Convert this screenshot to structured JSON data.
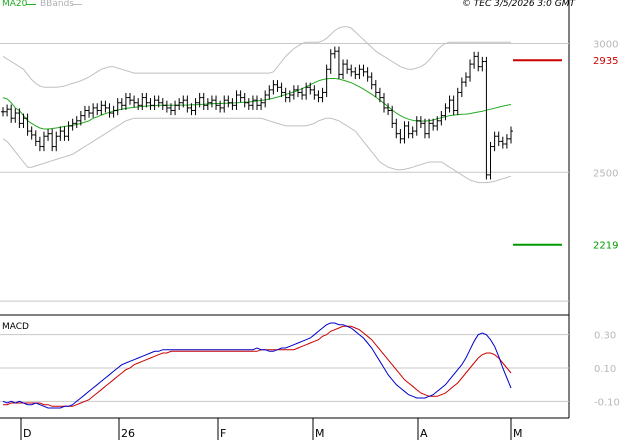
{
  "legend": {
    "ma_label": "MA20",
    "bb_label": "BBands",
    "ma_color": "#22aa22",
    "bb_color": "#c0c0c0"
  },
  "header": {
    "info": "© TEC 3/5/2026 3:0 GMT"
  },
  "price_axis": {
    "ticks": [
      {
        "label": "3000",
        "value": 3000
      },
      {
        "label": "2500",
        "value": 2500
      }
    ]
  },
  "levels": [
    {
      "label": "2935",
      "value": 2935,
      "color": "#cc0000"
    },
    {
      "label": "2219",
      "value": 2219,
      "color": "#009900"
    }
  ],
  "macd": {
    "title": "MACD",
    "ticks": [
      {
        "label": "0.30",
        "value": 0.3
      },
      {
        "label": "0.10",
        "value": 0.1
      },
      {
        "label": "-0.10",
        "value": -0.1
      }
    ],
    "macd_color": "#0000cc",
    "signal_color": "#cc0000"
  },
  "x_axis": {
    "labels": [
      "D",
      "26",
      "F",
      "M",
      "A",
      "M"
    ]
  },
  "chart_data": [
    {
      "type": "ohlc",
      "title": "",
      "x": [
        "D",
        "",
        "",
        "",
        "",
        "",
        "",
        "",
        "",
        "",
        "",
        "",
        "",
        "",
        "",
        "",
        "",
        "",
        "",
        "",
        "",
        "",
        "",
        "",
        "",
        "",
        "",
        "",
        "",
        "",
        "",
        "",
        "",
        "",
        "",
        "",
        "",
        "",
        "",
        "",
        "26",
        "",
        "",
        "",
        "",
        "",
        "",
        "",
        "",
        "",
        "",
        "",
        "",
        "",
        "",
        "",
        "",
        "",
        "",
        "",
        "",
        "",
        "",
        "",
        "",
        "",
        "",
        "",
        "",
        "",
        "F",
        "",
        "",
        "",
        "",
        "",
        "",
        "",
        "",
        "",
        "",
        "",
        "",
        "",
        "",
        "",
        "",
        "",
        "",
        "",
        "",
        "",
        "",
        "",
        "",
        "",
        "",
        "",
        "",
        "",
        "M",
        "",
        "",
        "",
        "",
        "",
        "",
        "",
        "",
        "",
        "",
        "",
        "",
        "",
        "",
        "",
        "",
        "",
        "",
        "",
        "",
        "",
        "",
        "",
        "",
        "",
        "",
        "",
        "",
        "",
        "A",
        "",
        "",
        "",
        "",
        "",
        "",
        "",
        "",
        "",
        "",
        "",
        "",
        "",
        "",
        "",
        "",
        "",
        "",
        "",
        "",
        "",
        "",
        "",
        "",
        "M"
      ],
      "ylim": [
        1950,
        3130
      ],
      "close": [
        2735,
        2745,
        2710,
        2730,
        2690,
        2710,
        2660,
        2645,
        2620,
        2600,
        2640,
        2650,
        2600,
        2640,
        2660,
        2640,
        2680,
        2690,
        2700,
        2720,
        2740,
        2730,
        2750,
        2740,
        2760,
        2750,
        2730,
        2740,
        2770,
        2760,
        2790,
        2780,
        2770,
        2760,
        2790,
        2770,
        2760,
        2780,
        2770,
        2760,
        2750,
        2740,
        2760,
        2770,
        2780,
        2750,
        2740,
        2770,
        2790,
        2760,
        2770,
        2780,
        2760,
        2750,
        2780,
        2770,
        2760,
        2800,
        2790,
        2770,
        2760,
        2780,
        2760,
        2770,
        2800,
        2820,
        2840,
        2830,
        2810,
        2790,
        2800,
        2820,
        2810,
        2800,
        2830,
        2820,
        2800,
        2790,
        2810,
        2900,
        2960,
        2970,
        2880,
        2920,
        2900,
        2890,
        2880,
        2900,
        2890,
        2870,
        2840,
        2810,
        2790,
        2750,
        2740,
        2690,
        2650,
        2630,
        2680,
        2650,
        2660,
        2700,
        2690,
        2650,
        2690,
        2680,
        2700,
        2720,
        2750,
        2780,
        2740,
        2810,
        2850,
        2870,
        2920,
        2950,
        2910,
        2930,
        2490,
        2600,
        2640,
        2620,
        2610,
        2630,
        2660
      ],
      "ma20": [
        2790,
        2785,
        2770,
        2750,
        2740,
        2720,
        2700,
        2690,
        2680,
        2672,
        2668,
        2668,
        2670,
        2672,
        2675,
        2678,
        2680,
        2683,
        2686,
        2690,
        2695,
        2700,
        2710,
        2715,
        2722,
        2728,
        2733,
        2738,
        2742,
        2745,
        2748,
        2750,
        2752,
        2754,
        2756,
        2757,
        2758,
        2759,
        2760,
        2760,
        2760,
        2760,
        2760,
        2761,
        2761,
        2761,
        2762,
        2762,
        2763,
        2764,
        2765,
        2766,
        2767,
        2767,
        2768,
        2768,
        2769,
        2770,
        2771,
        2772,
        2773,
        2775,
        2777,
        2779,
        2781,
        2784,
        2788,
        2792,
        2797,
        2802,
        2807,
        2812,
        2818,
        2825,
        2832,
        2840,
        2848,
        2855,
        2860,
        2863,
        2864,
        2864,
        2862,
        2858,
        2853,
        2848,
        2840,
        2832,
        2823,
        2813,
        2803,
        2792,
        2780,
        2768,
        2755,
        2742,
        2730,
        2720,
        2712,
        2706,
        2702,
        2699,
        2698,
        2699,
        2700,
        2703,
        2708,
        2712,
        2716,
        2720,
        2722,
        2724,
        2725,
        2726,
        2728,
        2731,
        2734,
        2737,
        2741,
        2745,
        2749,
        2753,
        2757,
        2760,
        2763
      ],
      "bb_upper": [
        2950,
        2940,
        2930,
        2920,
        2910,
        2900,
        2880,
        2860,
        2845,
        2835,
        2830,
        2830,
        2830,
        2830,
        2832,
        2835,
        2840,
        2845,
        2850,
        2855,
        2862,
        2870,
        2880,
        2890,
        2900,
        2905,
        2910,
        2910,
        2905,
        2900,
        2895,
        2890,
        2885,
        2885,
        2885,
        2885,
        2885,
        2885,
        2885,
        2885,
        2885,
        2885,
        2885,
        2885,
        2885,
        2885,
        2885,
        2885,
        2885,
        2885,
        2885,
        2885,
        2885,
        2885,
        2885,
        2885,
        2885,
        2885,
        2885,
        2885,
        2885,
        2885,
        2885,
        2885,
        2885,
        2885,
        2890,
        2910,
        2930,
        2950,
        2965,
        2980,
        2990,
        3000,
        3005,
        3005,
        3005,
        3005,
        3010,
        3020,
        3035,
        3050,
        3060,
        3065,
        3065,
        3060,
        3045,
        3030,
        3015,
        3000,
        2985,
        2970,
        2960,
        2950,
        2940,
        2930,
        2920,
        2910,
        2905,
        2900,
        2900,
        2905,
        2910,
        2920,
        2935,
        2955,
        2975,
        2990,
        3000,
        3005,
        3005,
        3005,
        3005,
        3005,
        3005,
        3005,
        3005,
        3005,
        3005,
        3005,
        3005,
        3005,
        3005,
        3005,
        3005
      ],
      "bb_lower": [
        2630,
        2620,
        2600,
        2580,
        2560,
        2540,
        2520,
        2520,
        2525,
        2530,
        2535,
        2540,
        2545,
        2550,
        2555,
        2560,
        2565,
        2570,
        2580,
        2590,
        2600,
        2610,
        2620,
        2630,
        2640,
        2650,
        2660,
        2670,
        2680,
        2690,
        2700,
        2705,
        2710,
        2710,
        2710,
        2710,
        2710,
        2710,
        2710,
        2710,
        2710,
        2710,
        2710,
        2710,
        2710,
        2710,
        2710,
        2710,
        2710,
        2710,
        2710,
        2710,
        2710,
        2710,
        2710,
        2710,
        2710,
        2710,
        2710,
        2710,
        2710,
        2710,
        2710,
        2710,
        2705,
        2700,
        2695,
        2690,
        2685,
        2680,
        2680,
        2680,
        2680,
        2680,
        2680,
        2685,
        2690,
        2700,
        2705,
        2710,
        2710,
        2705,
        2700,
        2690,
        2680,
        2670,
        2660,
        2640,
        2620,
        2600,
        2580,
        2560,
        2540,
        2530,
        2520,
        2515,
        2510,
        2510,
        2512,
        2515,
        2520,
        2525,
        2530,
        2535,
        2540,
        2540,
        2540,
        2540,
        2530,
        2520,
        2510,
        2500,
        2490,
        2480,
        2470,
        2465,
        2460,
        2460,
        2460,
        2462,
        2465,
        2470,
        2475,
        2480,
        2485
      ]
    },
    {
      "type": "line",
      "title": "MACD",
      "ylim": [
        -0.2,
        0.4
      ],
      "series": [
        {
          "values": [
            -0.1,
            -0.11,
            -0.1,
            -0.11,
            -0.1,
            -0.11,
            -0.12,
            -0.12,
            -0.11,
            -0.12,
            -0.13,
            -0.14,
            -0.14,
            -0.14,
            -0.14,
            -0.13,
            -0.13,
            -0.12,
            -0.1,
            -0.08,
            -0.06,
            -0.04,
            -0.02,
            0.0,
            0.02,
            0.04,
            0.06,
            0.08,
            0.1,
            0.12,
            0.13,
            0.14,
            0.15,
            0.16,
            0.17,
            0.18,
            0.19,
            0.2,
            0.2,
            0.21,
            0.21,
            0.21,
            0.21,
            0.21,
            0.21,
            0.21,
            0.21,
            0.21,
            0.21,
            0.21,
            0.21,
            0.21,
            0.21,
            0.21,
            0.21,
            0.21,
            0.21,
            0.21,
            0.21,
            0.21,
            0.21,
            0.21,
            0.22,
            0.21,
            0.21,
            0.2,
            0.2,
            0.21,
            0.22,
            0.22,
            0.23,
            0.24,
            0.25,
            0.26,
            0.27,
            0.28,
            0.3,
            0.32,
            0.34,
            0.36,
            0.37,
            0.37,
            0.36,
            0.36,
            0.35,
            0.34,
            0.32,
            0.3,
            0.28,
            0.25,
            0.22,
            0.18,
            0.14,
            0.1,
            0.06,
            0.03,
            0.0,
            -0.02,
            -0.04,
            -0.06,
            -0.07,
            -0.08,
            -0.08,
            -0.08,
            -0.07,
            -0.06,
            -0.04,
            -0.02,
            0.0,
            0.03,
            0.06,
            0.09,
            0.12,
            0.16,
            0.21,
            0.26,
            0.3,
            0.31,
            0.3,
            0.27,
            0.23,
            0.17,
            0.1,
            0.04,
            -0.02
          ]
        },
        {
          "values": [
            -0.12,
            -0.12,
            -0.11,
            -0.11,
            -0.11,
            -0.11,
            -0.11,
            -0.11,
            -0.11,
            -0.11,
            -0.12,
            -0.12,
            -0.13,
            -0.13,
            -0.13,
            -0.13,
            -0.13,
            -0.13,
            -0.12,
            -0.11,
            -0.1,
            -0.09,
            -0.07,
            -0.05,
            -0.03,
            -0.01,
            0.01,
            0.03,
            0.05,
            0.07,
            0.09,
            0.1,
            0.12,
            0.13,
            0.14,
            0.15,
            0.16,
            0.17,
            0.18,
            0.19,
            0.19,
            0.2,
            0.2,
            0.2,
            0.2,
            0.2,
            0.2,
            0.2,
            0.2,
            0.2,
            0.2,
            0.2,
            0.2,
            0.2,
            0.2,
            0.2,
            0.2,
            0.2,
            0.2,
            0.2,
            0.2,
            0.2,
            0.2,
            0.21,
            0.21,
            0.21,
            0.21,
            0.21,
            0.21,
            0.21,
            0.21,
            0.21,
            0.22,
            0.23,
            0.24,
            0.25,
            0.26,
            0.27,
            0.29,
            0.3,
            0.32,
            0.33,
            0.34,
            0.35,
            0.35,
            0.35,
            0.34,
            0.33,
            0.31,
            0.29,
            0.27,
            0.24,
            0.21,
            0.18,
            0.15,
            0.12,
            0.09,
            0.06,
            0.03,
            0.01,
            -0.01,
            -0.03,
            -0.05,
            -0.06,
            -0.07,
            -0.07,
            -0.07,
            -0.06,
            -0.05,
            -0.03,
            -0.01,
            0.01,
            0.04,
            0.07,
            0.1,
            0.13,
            0.16,
            0.18,
            0.19,
            0.19,
            0.18,
            0.16,
            0.13,
            0.1,
            0.07
          ]
        }
      ]
    }
  ]
}
